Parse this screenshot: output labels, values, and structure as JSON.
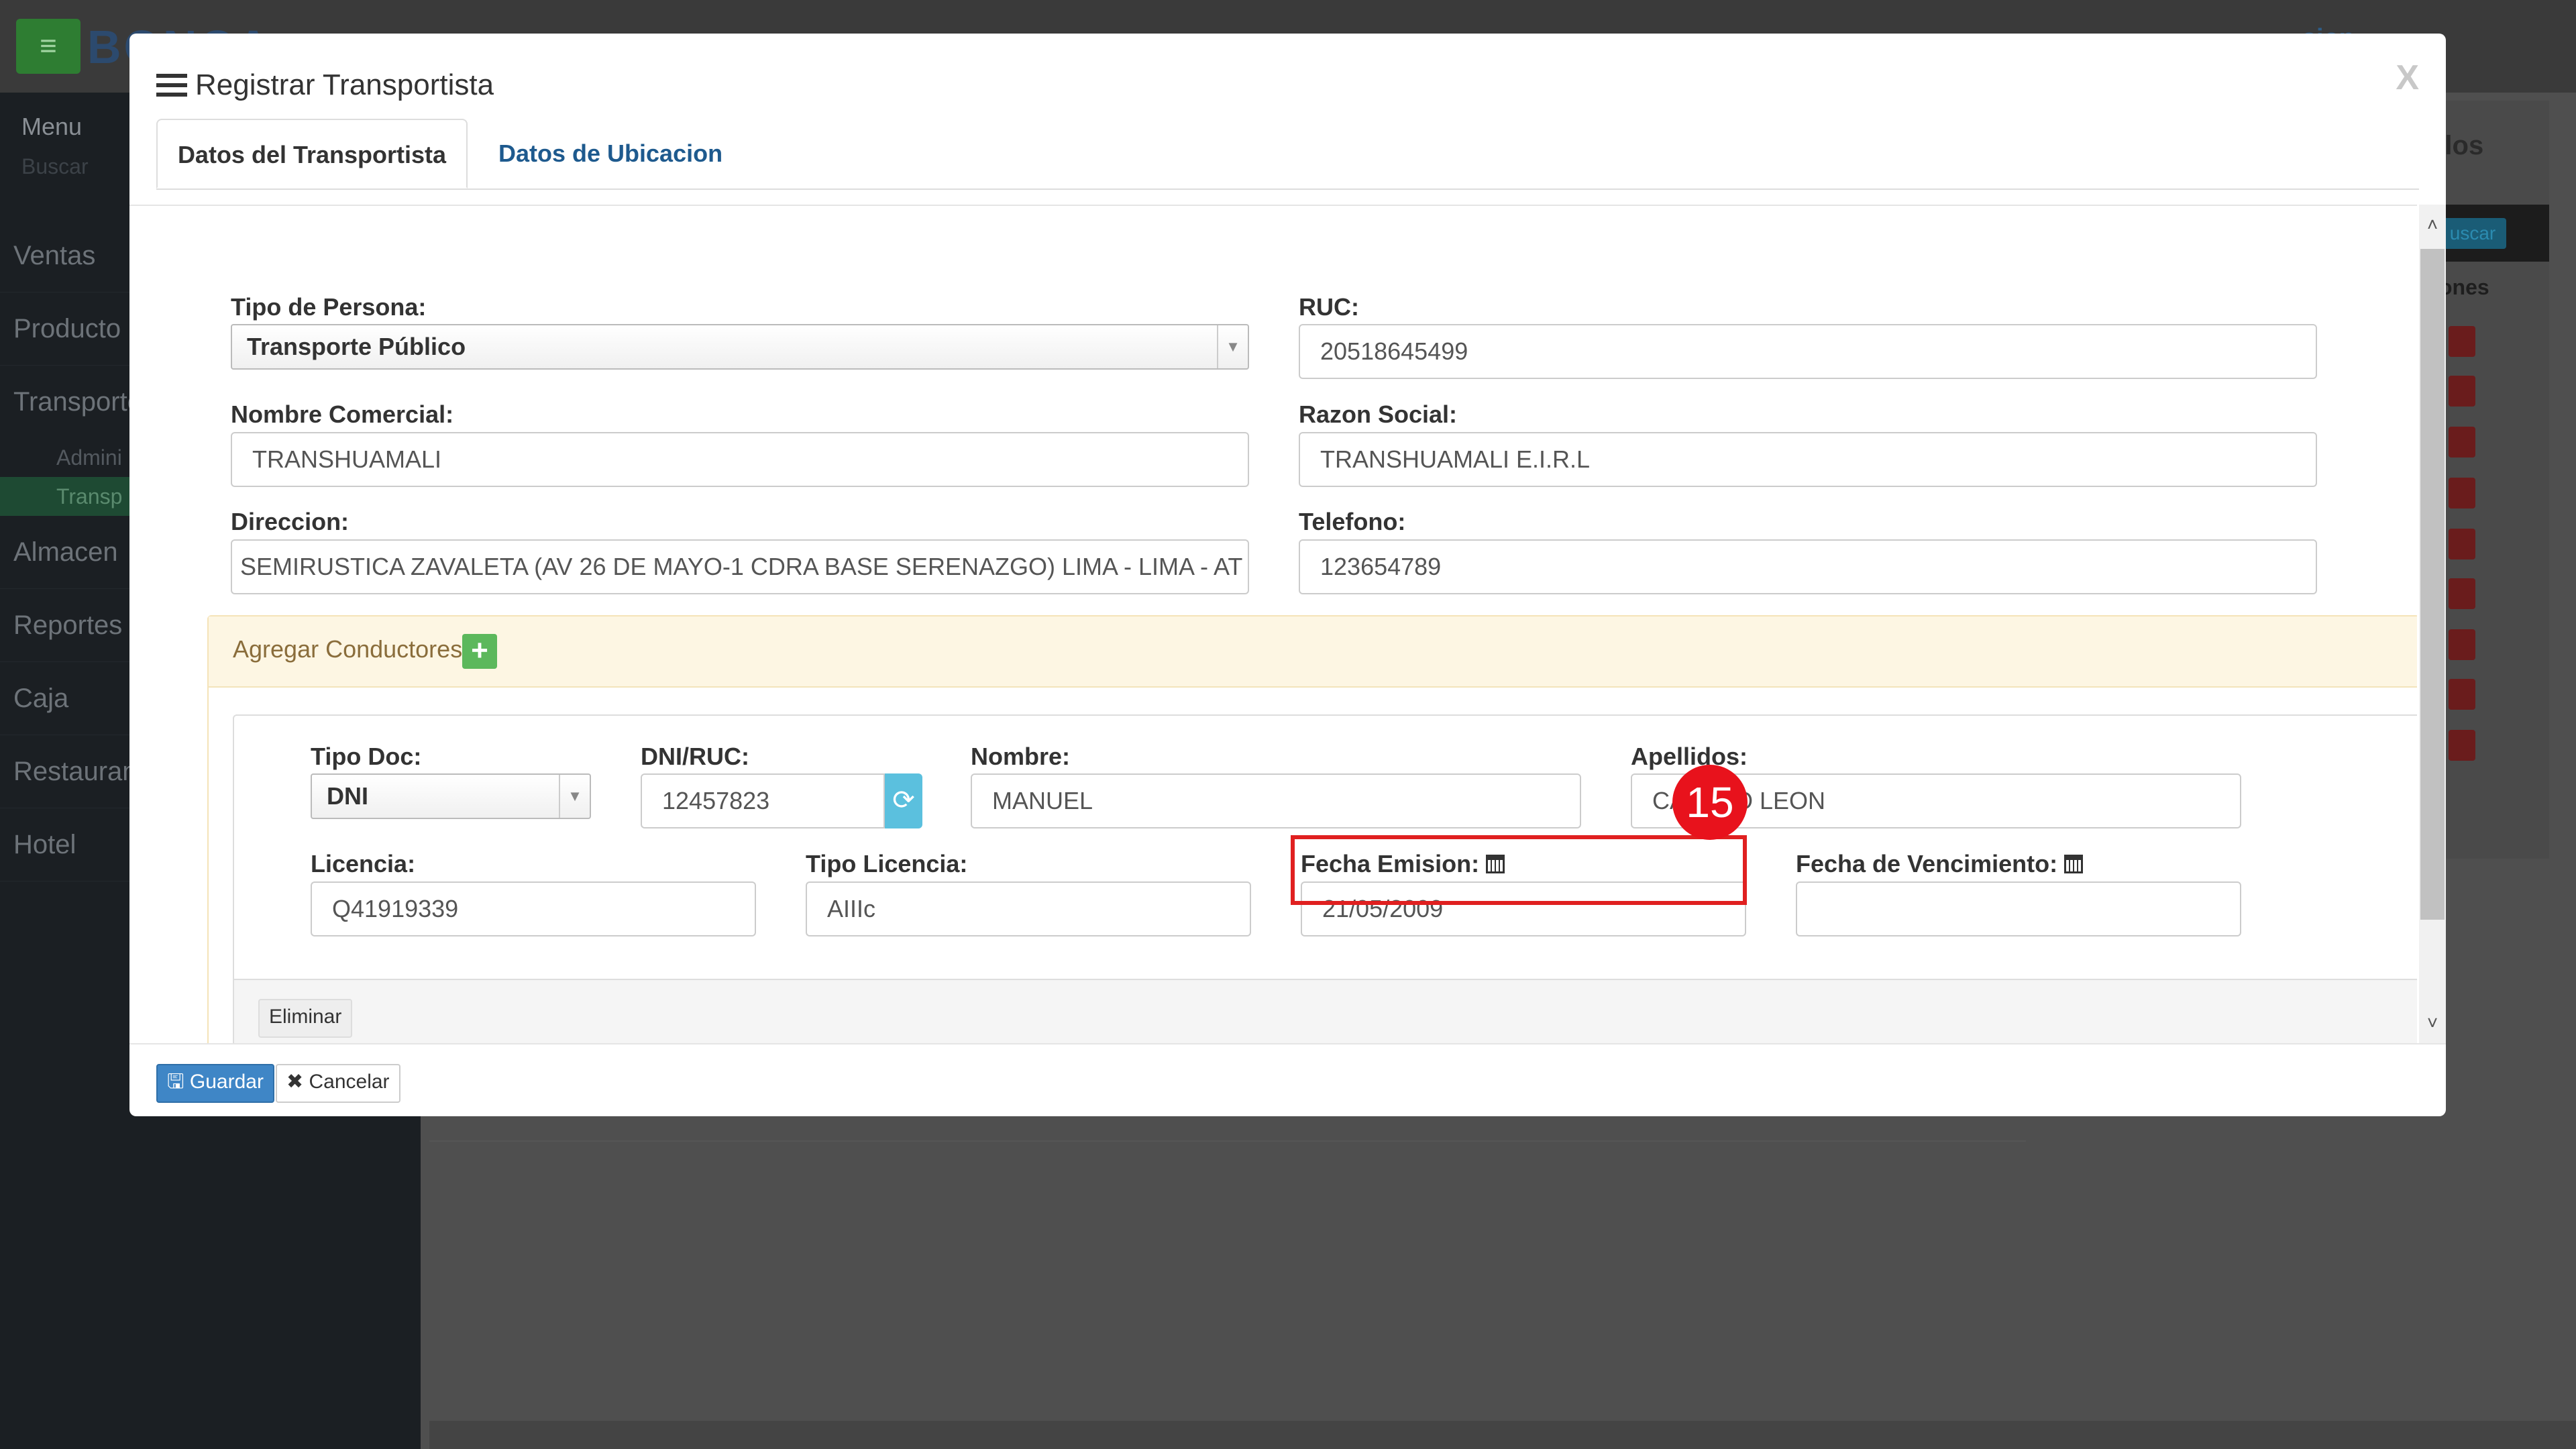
{
  "background": {
    "sidebar": {
      "header": "Menu",
      "search_placeholder": "Buscar",
      "items": [
        "Ventas",
        "Producto",
        "Transporte",
        "Almacen",
        "Reportes",
        "Caja",
        "Restaurant",
        "Hotel"
      ],
      "subitems": [
        "Admini",
        "Transp"
      ]
    },
    "brand": "BONCA",
    "session": "sion",
    "panel_title": "ulos",
    "search_button": "uscar",
    "column_header": "ones"
  },
  "modal": {
    "title": "Registrar Transportista",
    "close_label": "X",
    "tabs": [
      "Datos del Transportista",
      "Datos de Ubicacion"
    ],
    "fields": {
      "tipo_persona": {
        "label": "Tipo de Persona:",
        "value": "Transporte Público"
      },
      "ruc": {
        "label": "RUC:",
        "value": "20518645499"
      },
      "nombre_comercial": {
        "label": "Nombre Comercial:",
        "value": "TRANSHUAMALI"
      },
      "razon_social": {
        "label": "Razon Social:",
        "value": "TRANSHUAMALI E.I.R.L"
      },
      "direccion": {
        "label": "Direccion:",
        "value": "SEMIRUSTICA ZAVALETA (AV 26 DE MAYO-1 CDRA BASE SERENAZGO) LIMA - LIMA - AT"
      },
      "telefono": {
        "label": "Telefono:",
        "value": "123654789"
      }
    },
    "conductores": {
      "title": "Agregar Conductores",
      "add_label": "+",
      "tipo_doc": {
        "label": "Tipo Doc:",
        "value": "DNI"
      },
      "dni_ruc": {
        "label": "DNI/RUC:",
        "value": "12457823"
      },
      "nombre": {
        "label": "Nombre:",
        "value": "MANUEL"
      },
      "apellidos": {
        "label": "Apellidos:",
        "value": "CASTRO LEON"
      },
      "licencia": {
        "label": "Licencia:",
        "value": "Q41919339"
      },
      "tipo_licencia": {
        "label": "Tipo Licencia:",
        "value": "AIIIc"
      },
      "fecha_emision": {
        "label": "Fecha Emision:",
        "value": "21/05/2009"
      },
      "fecha_vencimiento": {
        "label": "Fecha de Vencimiento:",
        "value": ""
      },
      "delete_label": "Eliminar"
    },
    "annotation_badge": "15",
    "footer": {
      "save_label": "Guardar",
      "cancel_label": "Cancelar"
    }
  }
}
